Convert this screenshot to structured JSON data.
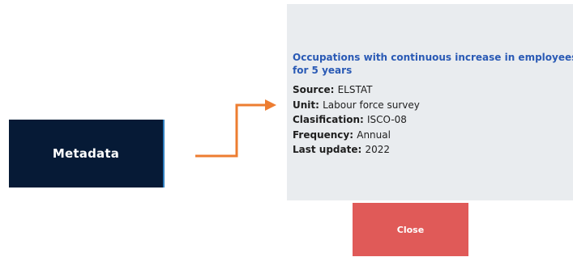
{
  "metadata_button": {
    "label": "Metadata"
  },
  "panel": {
    "title": "Occupations with continuous increase in employees for 5 years",
    "fields": [
      {
        "label": "Source",
        "value": "ELSTAT"
      },
      {
        "label": "Unit",
        "value": "Labour force survey"
      },
      {
        "label": "Clasification",
        "value": "ISCO-08"
      },
      {
        "label": "Frequency",
        "value": "Annual"
      },
      {
        "label": "Last update",
        "value": "2022"
      }
    ]
  },
  "close_button": {
    "label": "Close"
  },
  "colors": {
    "metadata_button_bg": "#061a36",
    "panel_bg": "#e9ecef",
    "title_blue": "#2a5ab5",
    "arrow_orange": "#ed7d31",
    "close_button_bg": "#e05a58"
  },
  "icons": {
    "connector": "orange-elbow-arrow-icon"
  }
}
